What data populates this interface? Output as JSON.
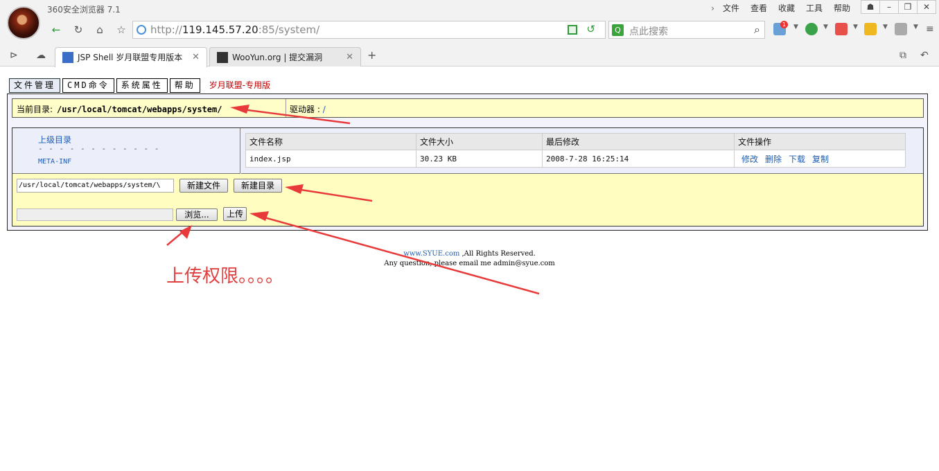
{
  "browser": {
    "title": "360安全浏览器 7.1",
    "menu": [
      "文件",
      "查看",
      "收藏",
      "工具",
      "帮助"
    ],
    "url_prefix": "http://",
    "url_host": "119.145.57.20",
    "url_rest": ":85/system/",
    "search_placeholder": "点此搜索",
    "badge_count": "1",
    "tabs": [
      {
        "label": "JSP Shell 岁月联盟专用版本",
        "active": true
      },
      {
        "label": "WooYun.org | 提交漏洞",
        "active": false
      }
    ]
  },
  "page": {
    "menu": [
      "文件管理",
      "CMD命令",
      "系统属性",
      "帮助"
    ],
    "brand": "岁月联盟-专用版",
    "cwd_label": "当前目录:",
    "cwd_path": "/usr/local/tomcat/webapps/system/",
    "drive_label": "驱动器 :",
    "drive_value": "/",
    "parent_dir": "上级目录",
    "dash": "- - - - - - - - - - - -",
    "dirs": [
      "META-INF"
    ],
    "file_headers": [
      "文件名称",
      "文件大小",
      "最后修改",
      "文件操作"
    ],
    "files": [
      {
        "name": "index.jsp",
        "size": "30.23 KB",
        "modified": "2008-7-28 16:25:14",
        "ops": [
          "修改",
          "删除",
          "下载",
          "复制"
        ]
      }
    ],
    "path_input": "/usr/local/tomcat/webapps/system/\\",
    "new_file": "新建文件",
    "new_dir": "新建目录",
    "browse": "浏览...",
    "upload": "上传",
    "footer_link": "www.SYUE.com",
    "footer_rights": " ,All Rights Reserved.",
    "footer_contact": "Any question, please email me admin@syue.com",
    "annotation": "上传权限。。。。"
  }
}
